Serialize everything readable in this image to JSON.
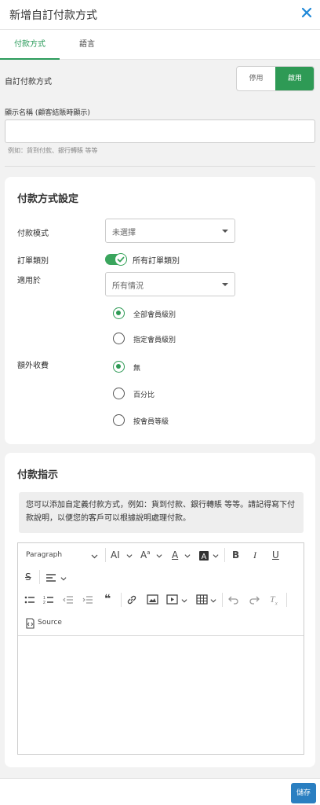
{
  "header": {
    "title": "新增自訂付款方式",
    "close_icon": "close-icon"
  },
  "tabs": [
    {
      "label": "付款方式",
      "active": true
    },
    {
      "label": "語言",
      "active": false
    }
  ],
  "custom_payment": {
    "label": "自訂付款方式",
    "disable_label": "停用",
    "enable_label": "啟用",
    "enabled": true
  },
  "display_name": {
    "label": "顯示名稱 (顧客結賬時顯示)",
    "value": "",
    "hint": "例如：貨到付款、銀行轉賬 等等"
  },
  "settings": {
    "title": "付款方式設定",
    "payment_mode": {
      "label": "付款模式",
      "value": "未選擇"
    },
    "order_type": {
      "label": "訂單類別",
      "switch_label": "所有訂單類別",
      "on": true
    },
    "applies_to": {
      "label": "適用於",
      "value": "所有情況",
      "options": [
        {
          "label": "全部會員級別",
          "checked": true
        },
        {
          "label": "指定會員級別",
          "checked": false
        }
      ]
    },
    "extra_fee": {
      "label": "額外收費",
      "options": [
        {
          "label": "無",
          "checked": true
        },
        {
          "label": "百分比",
          "checked": false
        },
        {
          "label": "按會員等級",
          "checked": false
        }
      ]
    }
  },
  "instructions": {
    "title": "付款指示",
    "notice": "您可以添加自定義付款方式，例如：貨到付款、銀行轉賬 等等。請記得寫下付款說明，以便您的客戶可以根據說明處理付款。",
    "editor": {
      "paragraph_label": "Paragraph",
      "source_label": "Source",
      "content": ""
    }
  },
  "footer": {
    "save_label": "儲存"
  },
  "colors": {
    "accent_green": "#2e9a55",
    "save_blue": "#2a7fc1"
  }
}
